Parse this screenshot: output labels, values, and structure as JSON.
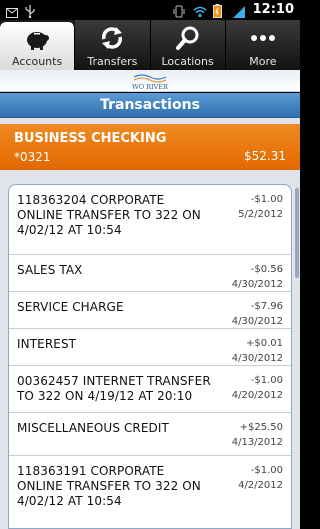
{
  "status_bar": {
    "time": "12:10",
    "left_icons": [
      "email-icon",
      "usb-icon"
    ],
    "right_icons": [
      "vibrate-icon",
      "wifi-icon",
      "battery-icon",
      "signal-icon"
    ]
  },
  "tabs": [
    {
      "label": "Accounts",
      "icon": "piggy-bank-icon",
      "active": true
    },
    {
      "label": "Transfers",
      "icon": "transfer-arrows-icon",
      "active": false
    },
    {
      "label": "Locations",
      "icon": "magnifier-icon",
      "active": false
    },
    {
      "label": "More",
      "icon": "more-dots-icon",
      "active": false
    }
  ],
  "header": {
    "logo_text": "TWO RIVERS",
    "title": "Transactions"
  },
  "account": {
    "name": "BUSINESS CHECKING",
    "number": "*0321",
    "balance": "$52.31",
    "accent_color": "#e8730a"
  },
  "transactions": [
    {
      "description": "118363204 CORPORATE ONLINE TRANSFER TO 322 ON 4/02/12 AT 10:54",
      "amount": "-$1.00",
      "date": "5/2/2012"
    },
    {
      "description": "SALES TAX",
      "amount": "-$0.56",
      "date": "4/30/2012"
    },
    {
      "description": "SERVICE CHARGE",
      "amount": "-$7.96",
      "date": "4/30/2012"
    },
    {
      "description": "INTEREST",
      "amount": "+$0.01",
      "date": "4/30/2012"
    },
    {
      "description": "00362457 INTERNET TRANSFER TO 322 ON 4/19/12 AT 20:10",
      "amount": "-$1.00",
      "date": "4/20/2012"
    },
    {
      "description": "MISCELLANEOUS CREDIT",
      "amount": "+$25.50",
      "date": "4/13/2012"
    },
    {
      "description": "118363191 CORPORATE ONLINE TRANSFER TO 322 ON 4/02/12 AT 10:54",
      "amount": "-$1.00",
      "date": "4/2/2012"
    }
  ]
}
